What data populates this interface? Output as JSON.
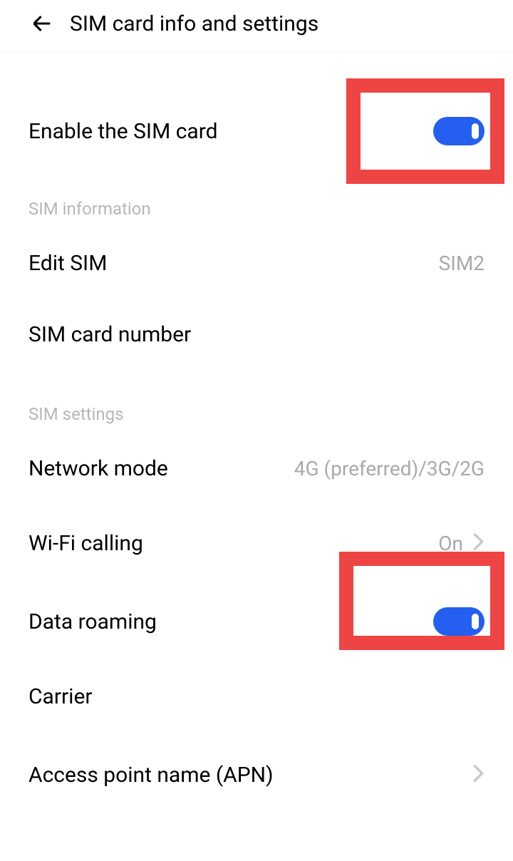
{
  "header": {
    "title": "SIM card info and settings"
  },
  "rows": {
    "enable_sim": {
      "label": "Enable the SIM card"
    },
    "edit_sim": {
      "label": "Edit SIM",
      "value": "SIM2"
    },
    "sim_card_number": {
      "label": "SIM card number"
    },
    "network_mode": {
      "label": "Network mode",
      "value": "4G (preferred)/3G/2G"
    },
    "wifi_calling": {
      "label": "Wi-Fi calling",
      "value": "On"
    },
    "data_roaming": {
      "label": "Data roaming"
    },
    "carrier": {
      "label": "Carrier"
    },
    "apn": {
      "label": "Access point name (APN)"
    }
  },
  "sections": {
    "sim_info": "SIM information",
    "sim_settings": "SIM settings"
  }
}
